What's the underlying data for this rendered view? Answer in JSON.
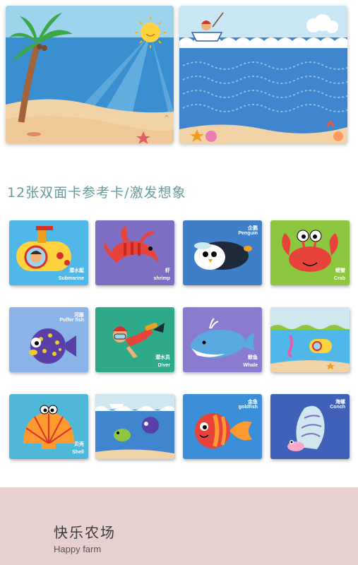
{
  "headline": "12张双面卡参考卡/激发想象",
  "cards": [
    {
      "cn": "潜水艇",
      "en": "Submarine",
      "bg": "#4fb8e8"
    },
    {
      "cn": "虾",
      "en": "shrimp",
      "bg": "#7d6ec4"
    },
    {
      "cn": "企鹅",
      "en": "Penguin",
      "bg": "#3f7fc7"
    },
    {
      "cn": "螃蟹",
      "en": "Crab",
      "bg": "#8dc63f"
    },
    {
      "cn": "河豚",
      "en": "Puffer fish",
      "bg": "#8ab4e8"
    },
    {
      "cn": "潜水员",
      "en": "Diver",
      "bg": "#2eaa8a"
    },
    {
      "cn": "鲸鱼",
      "en": "Whale",
      "bg": "#8a7ad0"
    },
    {
      "cn": "",
      "en": "",
      "bg": "#cfe8f0"
    },
    {
      "cn": "贝壳",
      "en": "Shell",
      "bg": "#4fb8d8"
    },
    {
      "cn": "",
      "en": "",
      "bg": "#2e5fa8"
    },
    {
      "cn": "金鱼",
      "en": "goldfish",
      "bg": "#3a8fd8"
    },
    {
      "cn": "海螺",
      "en": "Conch",
      "bg": "#3f62b8"
    }
  ],
  "footer": {
    "title_cn": "快乐农场",
    "title_en": "Happy farm"
  }
}
